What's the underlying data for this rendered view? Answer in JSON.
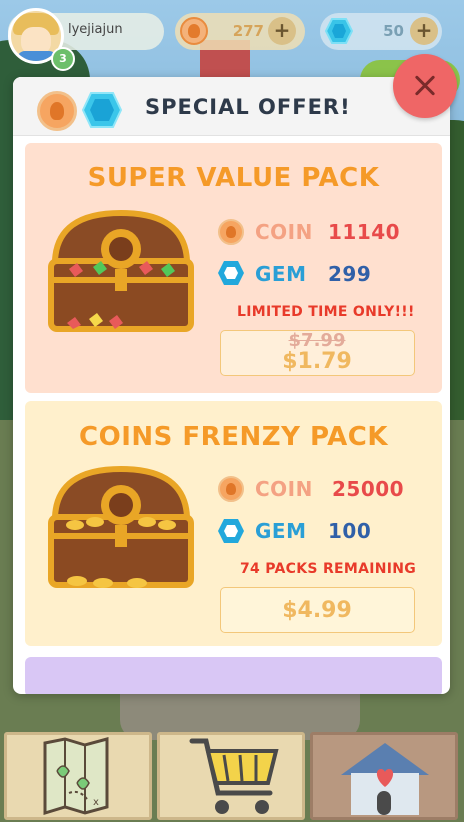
{
  "player": {
    "username": "lyejiajun",
    "level": "3"
  },
  "currency": {
    "coins": "277",
    "gems": "50",
    "add_label": "+"
  },
  "modal": {
    "title": "SPECIAL OFFER!",
    "close_label": "×"
  },
  "offers": [
    {
      "title": "SUPER VALUE PACK",
      "coin_label": "COIN",
      "coin_amount": "11140",
      "gem_label": "GEM",
      "gem_amount": "299",
      "promo": "LIMITED TIME ONLY!!!",
      "old_price": "$7.99",
      "price": "$1.79"
    },
    {
      "title": "COINS FRENZY PACK",
      "coin_label": "COIN",
      "coin_amount": "25000",
      "gem_label": "GEM",
      "gem_amount": "100",
      "promo": "74 PACKS REMAINING",
      "price": "$4.99"
    }
  ],
  "nav": {
    "items": [
      "map-icon",
      "shopping-cart-icon",
      "home-icon"
    ]
  },
  "colors": {
    "accent_orange": "#f59a28",
    "promo_red": "#e83a2a",
    "gem_blue": "#2a9fd6",
    "close_red": "#ef6666"
  }
}
